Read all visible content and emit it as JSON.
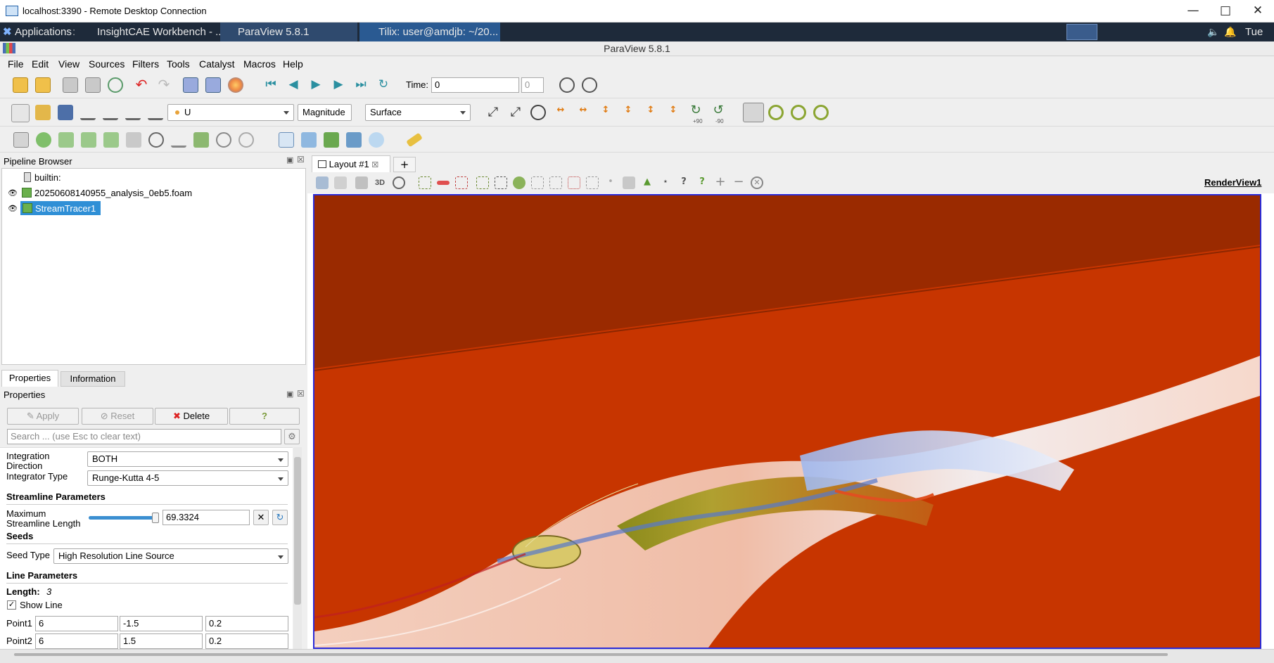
{
  "rdp": {
    "title": "localhost:3390 - Remote Desktop Connection"
  },
  "taskbar": {
    "applications": "Applications",
    "apps_menu_suffix": ":",
    "items": [
      "InsightCAE Workbench - ...",
      "ParaView 5.8.1",
      "Tilix: user@amdjb: ~/20..."
    ],
    "clock": "Tue"
  },
  "window": {
    "title": "ParaView 5.8.1"
  },
  "menu": [
    "File",
    "Edit",
    "View",
    "Sources",
    "Filters",
    "Tools",
    "Catalyst",
    "Macros",
    "Help"
  ],
  "time": {
    "label": "Time:",
    "value": "0",
    "index": "0"
  },
  "display": {
    "array": "U",
    "component": "Magnitude",
    "representation": "Surface"
  },
  "rotate_labels": {
    "plus90": "+90",
    "minus90": "-90"
  },
  "pipeline": {
    "title": "Pipeline Browser",
    "items": [
      {
        "label": "builtin:"
      },
      {
        "label": "20250608140955_analysis_0eb5.foam"
      },
      {
        "label": "StreamTracer1"
      }
    ]
  },
  "tabs": {
    "properties": "Properties",
    "information": "Information"
  },
  "properties": {
    "title": "Properties",
    "apply": "Apply",
    "reset": "Reset",
    "delete": "Delete",
    "help": "?",
    "search_placeholder": "Search ... (use Esc to clear text)",
    "integration_direction_label": "Integration Direction",
    "integration_direction": "BOTH",
    "integrator_type_label": "Integrator Type",
    "integrator_type": "Runge-Kutta 4-5",
    "streamline_header": "Streamline Parameters",
    "max_length_label": "Maximum Streamline Length",
    "max_length": "69.3324",
    "max_length_slider_fraction": 0.98,
    "seeds_header": "Seeds",
    "seed_type_label": "Seed Type",
    "seed_type": "High Resolution Line Source",
    "line_header": "Line Parameters",
    "length_label": "Length:",
    "length_value": "3",
    "show_line": "Show Line",
    "point1_label": "Point1",
    "point1": [
      "6",
      "-1.5",
      "0.2"
    ],
    "point2_label": "Point2",
    "point2": [
      "6",
      "1.5",
      "0.2"
    ]
  },
  "layout": {
    "tab": "Layout #1",
    "add": "+",
    "view_3d": "3D",
    "render_view": "RenderView1"
  },
  "colors": {
    "accent": "#2b2bd8",
    "selection": "#2f8fd6",
    "surface": "#c23300"
  }
}
